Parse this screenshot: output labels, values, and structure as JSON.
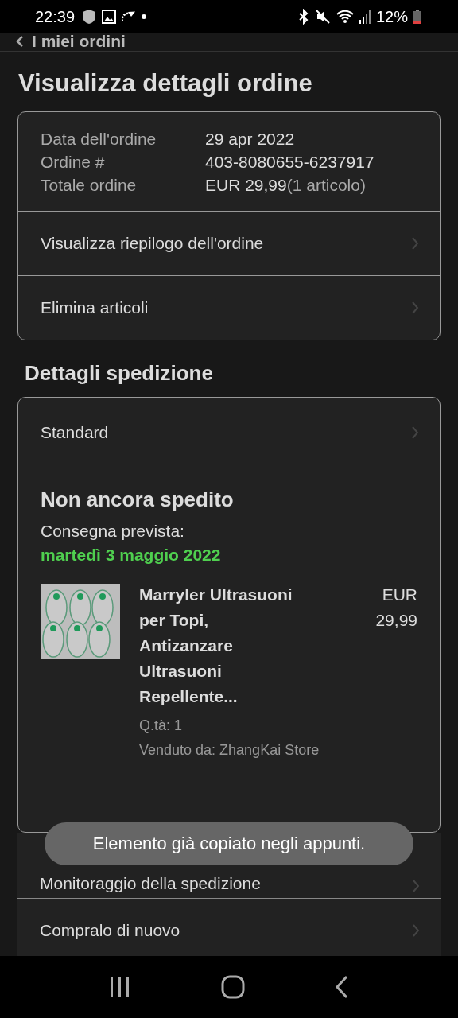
{
  "status_bar": {
    "time": "22:39",
    "battery": "12%"
  },
  "header": {
    "back_label": "I miei ordini"
  },
  "title": "Visualizza dettagli ordine",
  "order_summary": {
    "fields": [
      {
        "label": "Data dell'ordine",
        "value": "29 apr 2022"
      },
      {
        "label": "Ordine #",
        "value": "403-8080655-6237917"
      },
      {
        "label": "Totale ordine",
        "value": "EUR 29,99",
        "note": "(1 articolo)"
      }
    ],
    "links": [
      "Visualizza riepilogo dell'ordine",
      "Elimina articoli"
    ]
  },
  "shipping": {
    "title": "Dettagli spedizione",
    "method": "Standard",
    "status": "Non ancora spedito",
    "delivery_label": "Consegna prevista:",
    "delivery_date": "martedì 3 maggio 2022",
    "item": {
      "name": "Marryler Ultrasuoni per Topi, Antizanzare Ultrasuoni Repellente...",
      "price": "EUR 29,99",
      "quantity": "Q.tà: 1",
      "seller": "Venduto da: ZhangKai Store"
    }
  },
  "more_actions": [
    "Monitoraggio della spedizione",
    "Compralo di nuovo"
  ],
  "toast": "Elemento già copiato negli appunti."
}
